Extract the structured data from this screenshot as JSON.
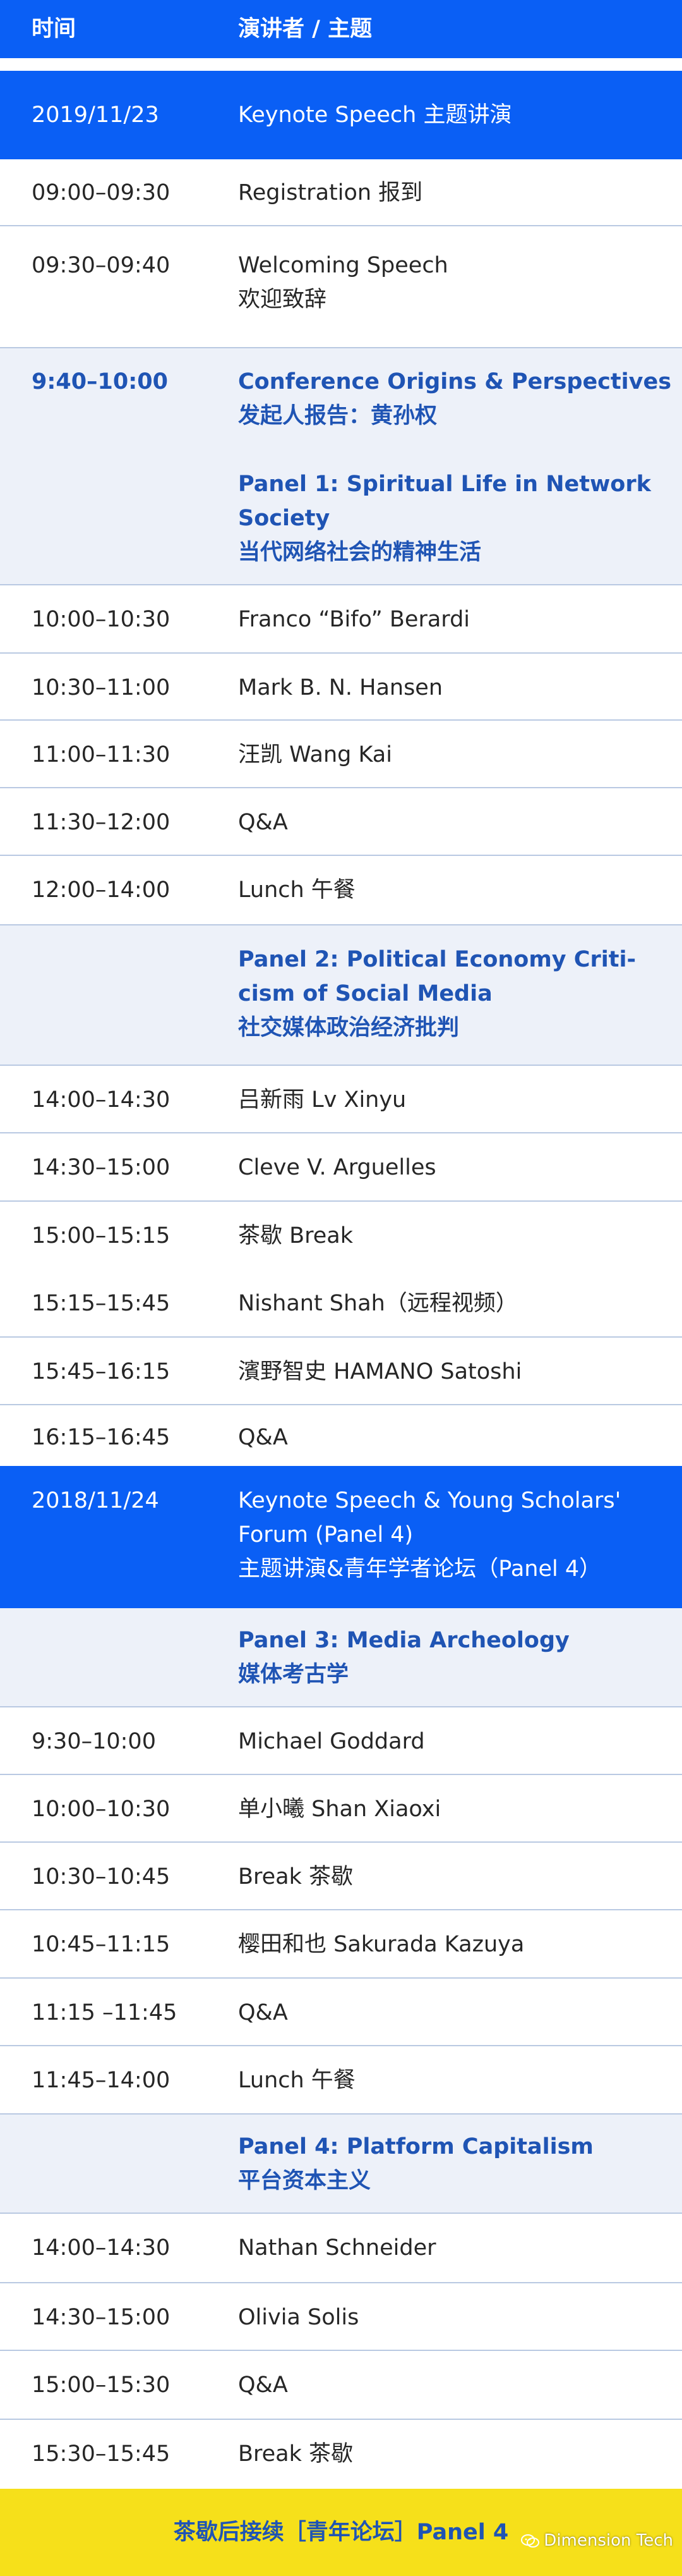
{
  "header": {
    "col_time": "时间",
    "col_speaker": "演讲者 / 主题"
  },
  "rows": [
    {
      "time": "2019/11/23",
      "lines": [
        "Keynote Speech 主题讲演"
      ]
    },
    {
      "time": "09:00–09:30",
      "lines": [
        "Registration 报到"
      ]
    },
    {
      "time": "09:30–09:40",
      "lines": [
        "Welcoming Speech",
        "欢迎致辞"
      ]
    },
    {
      "time": "9:40–10:00",
      "lines": [
        "Conference Origins & Perspectives",
        "发起人报告：黄孙权",
        "",
        "Panel 1: Spiritual Life in Network",
        "Society",
        "当代网络社会的精神生活"
      ]
    },
    {
      "time": "10:00–10:30",
      "lines": [
        "Franco “Bifo” Berardi"
      ]
    },
    {
      "time": "10:30–11:00",
      "lines": [
        "Mark B. N. Hansen"
      ]
    },
    {
      "time": "11:00–11:30",
      "lines": [
        "汪凯 Wang Kai"
      ]
    },
    {
      "time": "11:30–12:00",
      "lines": [
        "Q&A"
      ]
    },
    {
      "time": "12:00–14:00",
      "lines": [
        "Lunch 午餐"
      ]
    },
    {
      "time": "",
      "lines": [
        "Panel 2: Political Economy Criti-",
        "cism of Social Media",
        "社交媒体政治经济批判"
      ]
    },
    {
      "time": "14:00–14:30",
      "lines": [
        "吕新雨 Lv Xinyu"
      ]
    },
    {
      "time": "14:30–15:00",
      "lines": [
        "Cleve V. Arguelles"
      ]
    },
    {
      "time": "15:00–15:15",
      "lines": [
        "茶歇 Break"
      ]
    },
    {
      "time": "15:15–15:45",
      "lines": [
        "Nishant Shah（远程视频）"
      ]
    },
    {
      "time": "15:45–16:15",
      "lines": [
        "濱野智史 HAMANO Satoshi"
      ]
    },
    {
      "time": "16:15–16:45",
      "lines": [
        "Q&A"
      ]
    },
    {
      "time": "2018/11/24",
      "lines": [
        "Keynote Speech & Young Scholars'",
        "Forum (Panel 4)",
        "主题讲演&青年学者论坛（Panel 4）"
      ]
    },
    {
      "time": "",
      "lines": [
        "Panel 3: Media Archeology",
        "媒体考古学"
      ]
    },
    {
      "time": "9:30–10:00",
      "lines": [
        "Michael Goddard"
      ]
    },
    {
      "time": "10:00–10:30",
      "lines": [
        "单小曦 Shan Xiaoxi"
      ]
    },
    {
      "time": "10:30–10:45",
      "lines": [
        "Break 茶歇"
      ]
    },
    {
      "time": "10:45–11:15",
      "lines": [
        "樱田和也 Sakurada Kazuya"
      ]
    },
    {
      "time": "11:15 –11:45",
      "lines": [
        "Q&A"
      ]
    },
    {
      "time": "11:45–14:00",
      "lines": [
        "Lunch 午餐"
      ]
    },
    {
      "time": "",
      "lines": [
        "Panel 4: Platform Capitalism",
        "平台资本主义"
      ]
    },
    {
      "time": "14:00–14:30",
      "lines": [
        "Nathan Schneider"
      ]
    },
    {
      "time": "14:30–15:00",
      "lines": [
        "Olivia Solis"
      ]
    },
    {
      "time": "15:00–15:30",
      "lines": [
        "Q&A"
      ]
    },
    {
      "time": "15:30–15:45",
      "lines": [
        "Break 茶歇"
      ]
    }
  ],
  "footer": {
    "text": "茶歇后接续［青年论坛］Panel 4"
  },
  "watermark": {
    "text": "Dimension Tech",
    "icon": "wechat-icon"
  },
  "colors": {
    "blue": "#0a5ff5",
    "panel_blue": "#1f54b4",
    "light_row": "#edf1f9",
    "divider": "#b9c9e2",
    "footer_yellow": "#f6e01a"
  }
}
